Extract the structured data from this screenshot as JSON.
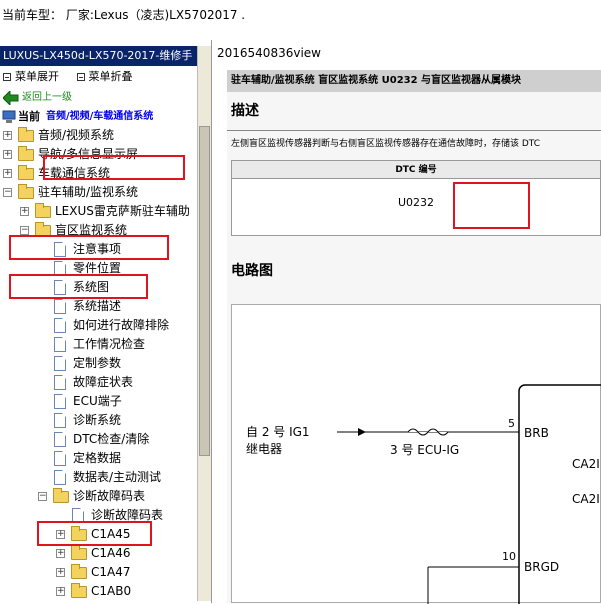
{
  "header": {
    "current_vehicle": "当前车型：  厂家:Lexus（凌志)LX5702017   ."
  },
  "left": {
    "title": "LUXUS-LX450d-LX570-2017-维修手",
    "expand_all": "菜单展开",
    "collapse_all": "菜单折叠",
    "back": "返回上一级",
    "current_path": "当前",
    "current_path_value": "音频/视频/车载通信系统",
    "tree": [
      {
        "label": "音频/视频系统"
      },
      {
        "label": "导航/多信息显示屏"
      },
      {
        "label": "车载通信系统"
      },
      {
        "label": "驻车辅助/监视系统"
      },
      {
        "label": "LEXUS雷克萨斯驻车辅助"
      },
      {
        "label": "盲区监视系统"
      },
      {
        "label": "注意事项"
      },
      {
        "label": "零件位置"
      },
      {
        "label": "系统图"
      },
      {
        "label": "系统描述"
      },
      {
        "label": "如何进行故障排除"
      },
      {
        "label": "工作情况检查"
      },
      {
        "label": "定制参数"
      },
      {
        "label": "故障症状表"
      },
      {
        "label": "ECU端子"
      },
      {
        "label": "诊断系统"
      },
      {
        "label": "DTC检查/清除"
      },
      {
        "label": "定格数据"
      },
      {
        "label": "数据表/主动测试"
      },
      {
        "label": "诊断故障码表"
      },
      {
        "label": "诊断故障码表"
      },
      {
        "label": "C1A45"
      },
      {
        "label": "C1A46"
      },
      {
        "label": "C1A47"
      },
      {
        "label": "C1AB0"
      }
    ]
  },
  "right": {
    "url": "2016540836view",
    "breadcrumb": "驻车辅助/监视系统  盲区监视系统  U0232  与盲区监视器从属模块",
    "desc_heading": "描述",
    "desc_text": "左侧盲区监视传感器判断与右侧盲区监视传感器存在通信故障时，存储该 DTC",
    "dtc_header": "DTC 编号",
    "dtc_code": "U0232",
    "circuit_heading": "电路图",
    "circuit": {
      "source_line1": "自 2 号 IG1",
      "source_line2": "继电器",
      "fuse": "3 号 ECU-IG",
      "pin5": "5",
      "pin10": "10",
      "brb": "BRB",
      "brgd": "BRGD",
      "ca1": "CA2I",
      "ca2": "CA2I"
    }
  },
  "colors": {
    "highlight": "#e0141e",
    "title_bar": "#0a246a",
    "link_blue": "#0000ee",
    "leaf_green": "#1f8a1f"
  }
}
